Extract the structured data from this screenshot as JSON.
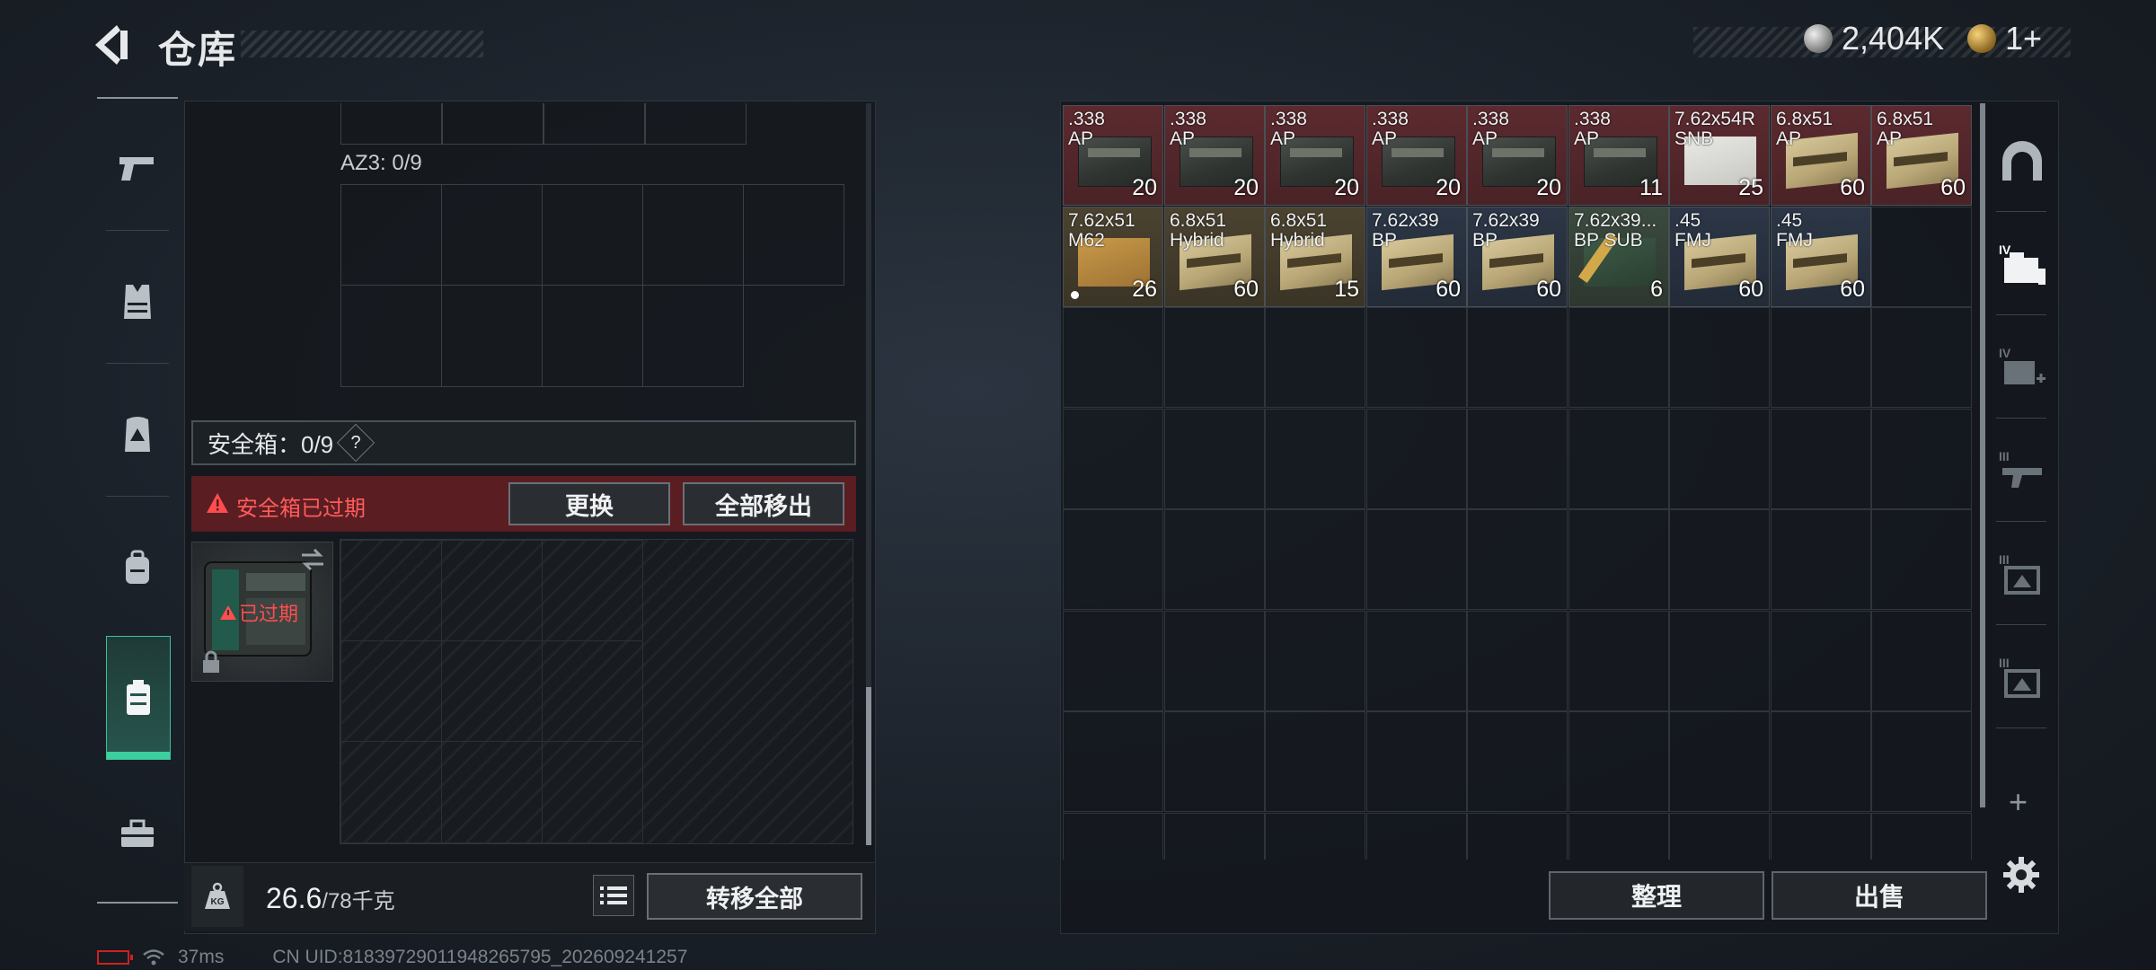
{
  "header": {
    "title": "仓库",
    "silver_amount": "2,404K",
    "gold_amount": "1+"
  },
  "left_nav": {
    "items": [
      {
        "name": "weapon-pistol",
        "icon": "pistol-icon"
      },
      {
        "name": "armor-vest",
        "icon": "vest-icon"
      },
      {
        "name": "chest-rig",
        "icon": "chest-rig-icon"
      },
      {
        "name": "backpack",
        "icon": "backpack-icon"
      },
      {
        "name": "secure-container",
        "icon": "container-icon",
        "active": true
      },
      {
        "name": "toolbox",
        "icon": "toolbox-icon"
      }
    ]
  },
  "container": {
    "az3_label": "AZ3: 0/9",
    "secure_label": "安全箱：0/9",
    "help_mark": "?",
    "expired_warning": "安全箱已过期",
    "replace_button": "更换",
    "remove_all_button": "全部移出",
    "expired_badge": "已过期",
    "weight_value": "26.6",
    "weight_max": "/78千克",
    "transfer_all_button": "转移全部"
  },
  "stash": {
    "items": [
      {
        "name": ".338\nAP",
        "count": "20",
        "color": "red",
        "box": "dark"
      },
      {
        "name": ".338\nAP",
        "count": "20",
        "color": "red",
        "box": "dark"
      },
      {
        "name": ".338\nAP",
        "count": "20",
        "color": "red",
        "box": "dark"
      },
      {
        "name": ".338\nAP",
        "count": "20",
        "color": "red",
        "box": "dark"
      },
      {
        "name": ".338\nAP",
        "count": "20",
        "color": "red",
        "box": "dark"
      },
      {
        "name": ".338\nAP",
        "count": "11",
        "color": "red",
        "box": "dark"
      },
      {
        "name": "7.62x54R\nSNB",
        "count": "25",
        "color": "red",
        "box": "white"
      },
      {
        "name": "6.8x51\nAP",
        "count": "60",
        "color": "red",
        "box": "tan"
      },
      {
        "name": "6.8x51\nAP",
        "count": "60",
        "color": "red",
        "box": "tan"
      },
      {
        "name": "7.62x51\nM62",
        "count": "26",
        "color": "gold",
        "box": "cardboard",
        "dot": true
      },
      {
        "name": "6.8x51\nHybrid",
        "count": "60",
        "color": "gold",
        "box": "tan"
      },
      {
        "name": "6.8x51\nHybrid",
        "count": "15",
        "color": "gold",
        "box": "tan"
      },
      {
        "name": "7.62x39\nBP",
        "count": "60",
        "color": "blue",
        "box": "tan"
      },
      {
        "name": "7.62x39\nBP",
        "count": "60",
        "color": "blue",
        "box": "tan"
      },
      {
        "name": "7.62x39...\nBP SUB",
        "count": "6",
        "color": "green",
        "box": "green"
      },
      {
        "name": ".45\nFMJ",
        "count": "60",
        "color": "blue",
        "box": "tan"
      },
      {
        "name": ".45\nFMJ",
        "count": "60",
        "color": "blue",
        "box": "tan"
      }
    ],
    "sort_button": "整理",
    "sell_button": "出售"
  },
  "right_nav": {
    "add": "+"
  },
  "status_bar": {
    "ping": "37ms",
    "uid": "CN UID:8183972901194826579​5_202609241257"
  },
  "colors": {
    "accent_green": "#3fbf9c",
    "warning_red": "#ff5b5b",
    "expired_bg": "#5a1d22"
  }
}
